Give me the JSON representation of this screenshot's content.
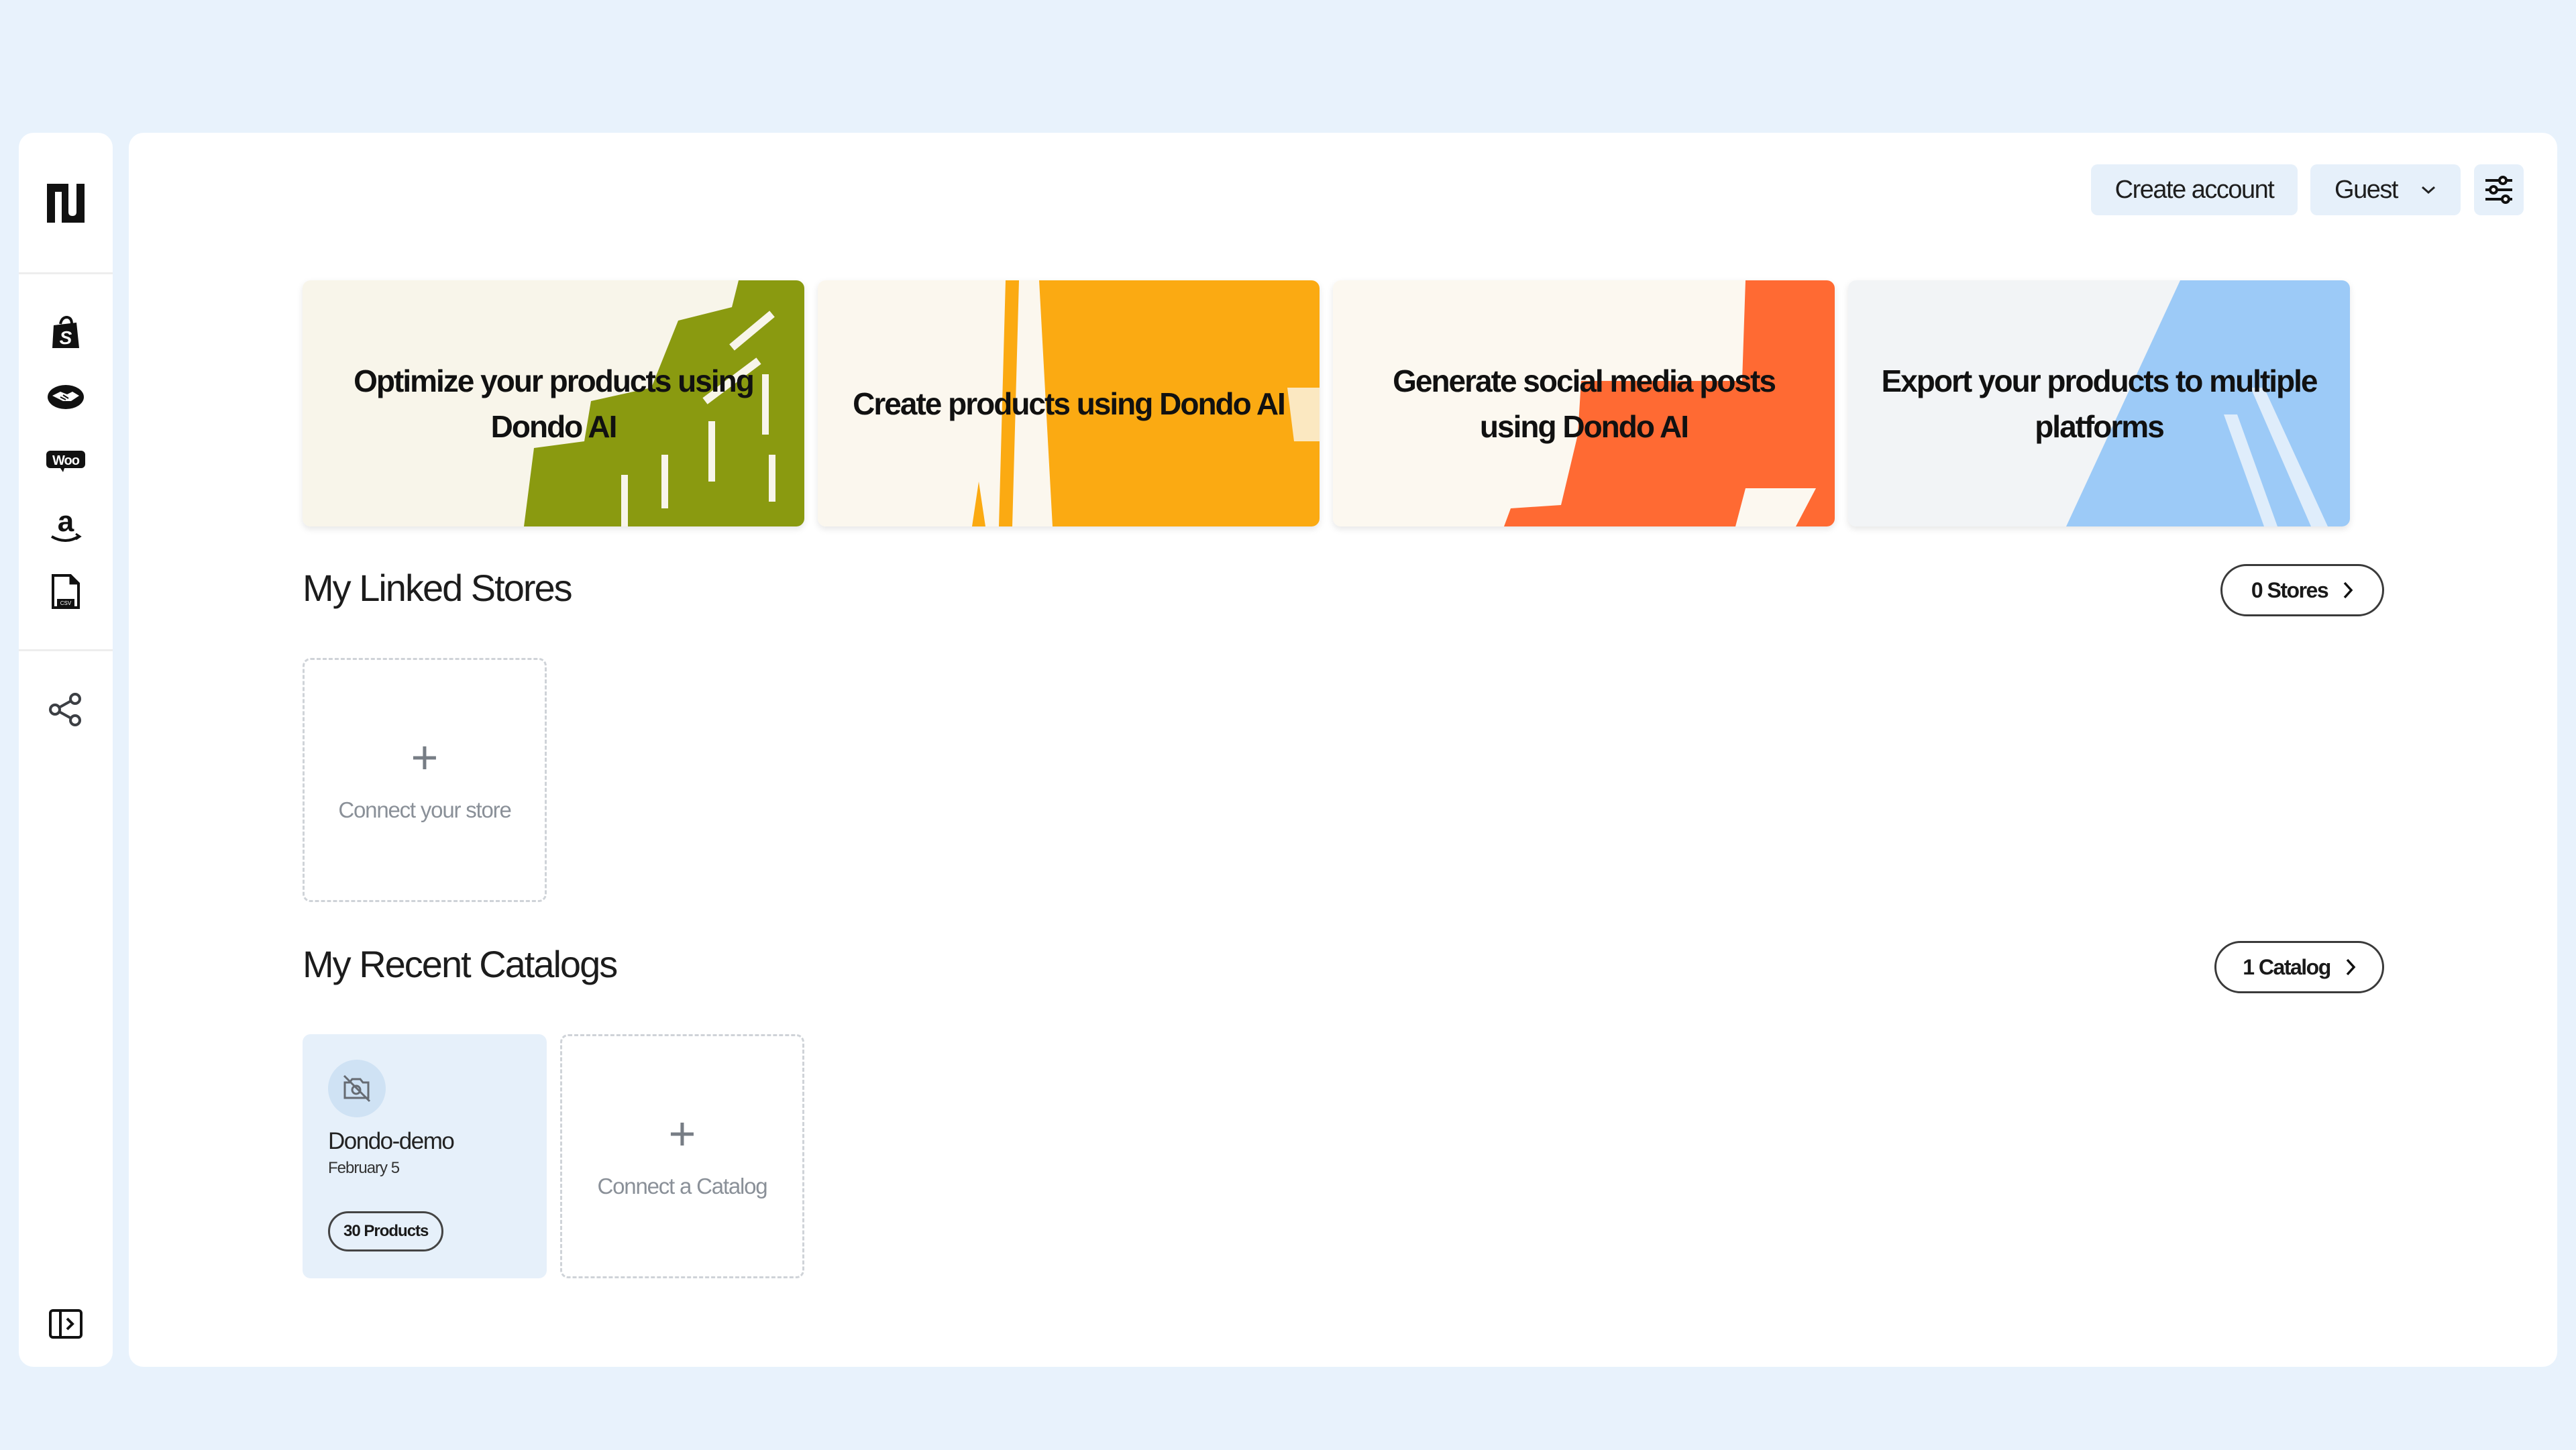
{
  "sidebar": {
    "logo": "dondo-logo",
    "items": [
      {
        "id": "shopify",
        "icon": "shopify-icon",
        "label": "Shopify"
      },
      {
        "id": "handshake",
        "icon": "handshake-icon",
        "label": "Partner marketplace"
      },
      {
        "id": "woocommerce",
        "icon": "woocommerce-icon",
        "label": "WooCommerce",
        "glyph": "Woo"
      },
      {
        "id": "amazon",
        "icon": "amazon-icon",
        "label": "Amazon",
        "glyph": "a"
      },
      {
        "id": "csv",
        "icon": "csv-file-icon",
        "label": "CSV",
        "glyph": "CSV"
      }
    ],
    "share": {
      "icon": "share-icon",
      "label": "Share"
    },
    "collapse": {
      "icon": "expand-sidebar-icon",
      "label": "Expand sidebar"
    }
  },
  "header": {
    "create_account": "Create account",
    "user_menu": "Guest",
    "settings_icon": "sliders-icon"
  },
  "banners": [
    {
      "text": "Optimize your products using Dondo AI",
      "color": "#8a9a10"
    },
    {
      "text": "Create products using Dondo AI",
      "color": "#fbaa12"
    },
    {
      "text": "Generate social media posts using Dondo AI",
      "color": "#ff6a33"
    },
    {
      "text": "Export your products to multiple platforms",
      "color": "#9ccaf7"
    }
  ],
  "stores": {
    "title": "My Linked Stores",
    "count_label": "0 Stores",
    "connect_label": "Connect your store"
  },
  "catalogs": {
    "title": "My Recent Catalogs",
    "count_label": "1 Catalog",
    "items": [
      {
        "name": "Dondo-demo",
        "date": "February 5",
        "badge": "30 Products",
        "icon": "no-image-icon"
      }
    ],
    "connect_label": "Connect a Catalog"
  },
  "colors": {
    "page_bg": "#e8f2fc",
    "button_bg": "#e6f0fa",
    "catalog_card_bg": "#e6f0fa"
  }
}
